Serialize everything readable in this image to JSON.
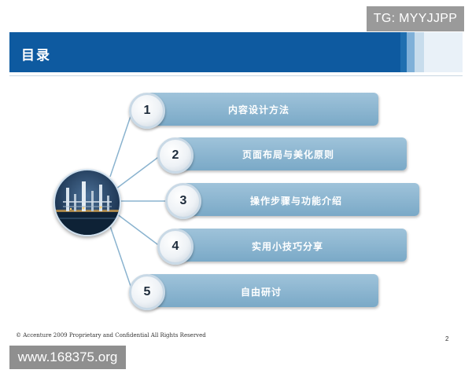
{
  "watermark_top": "TG: MYYJJPP",
  "slide": {
    "title": "目录",
    "items": [
      {
        "number": "1",
        "label": "内容设计方法"
      },
      {
        "number": "2",
        "label": "页面布局与美化原则"
      },
      {
        "number": "3",
        "label": "操作步骤与功能介绍"
      },
      {
        "number": "4",
        "label": "实用小技巧分享"
      },
      {
        "number": "5",
        "label": "自由研讨"
      }
    ],
    "footer": "© Accenture 2009 Proprietary and Confidential All Rights Reserved",
    "page_number": "2"
  },
  "watermark_bottom": "www.168375.org",
  "colors": {
    "header": "#0e5aa0",
    "pill": "#8db7d2"
  },
  "icons": {
    "hub": "oil-rig-photo"
  }
}
